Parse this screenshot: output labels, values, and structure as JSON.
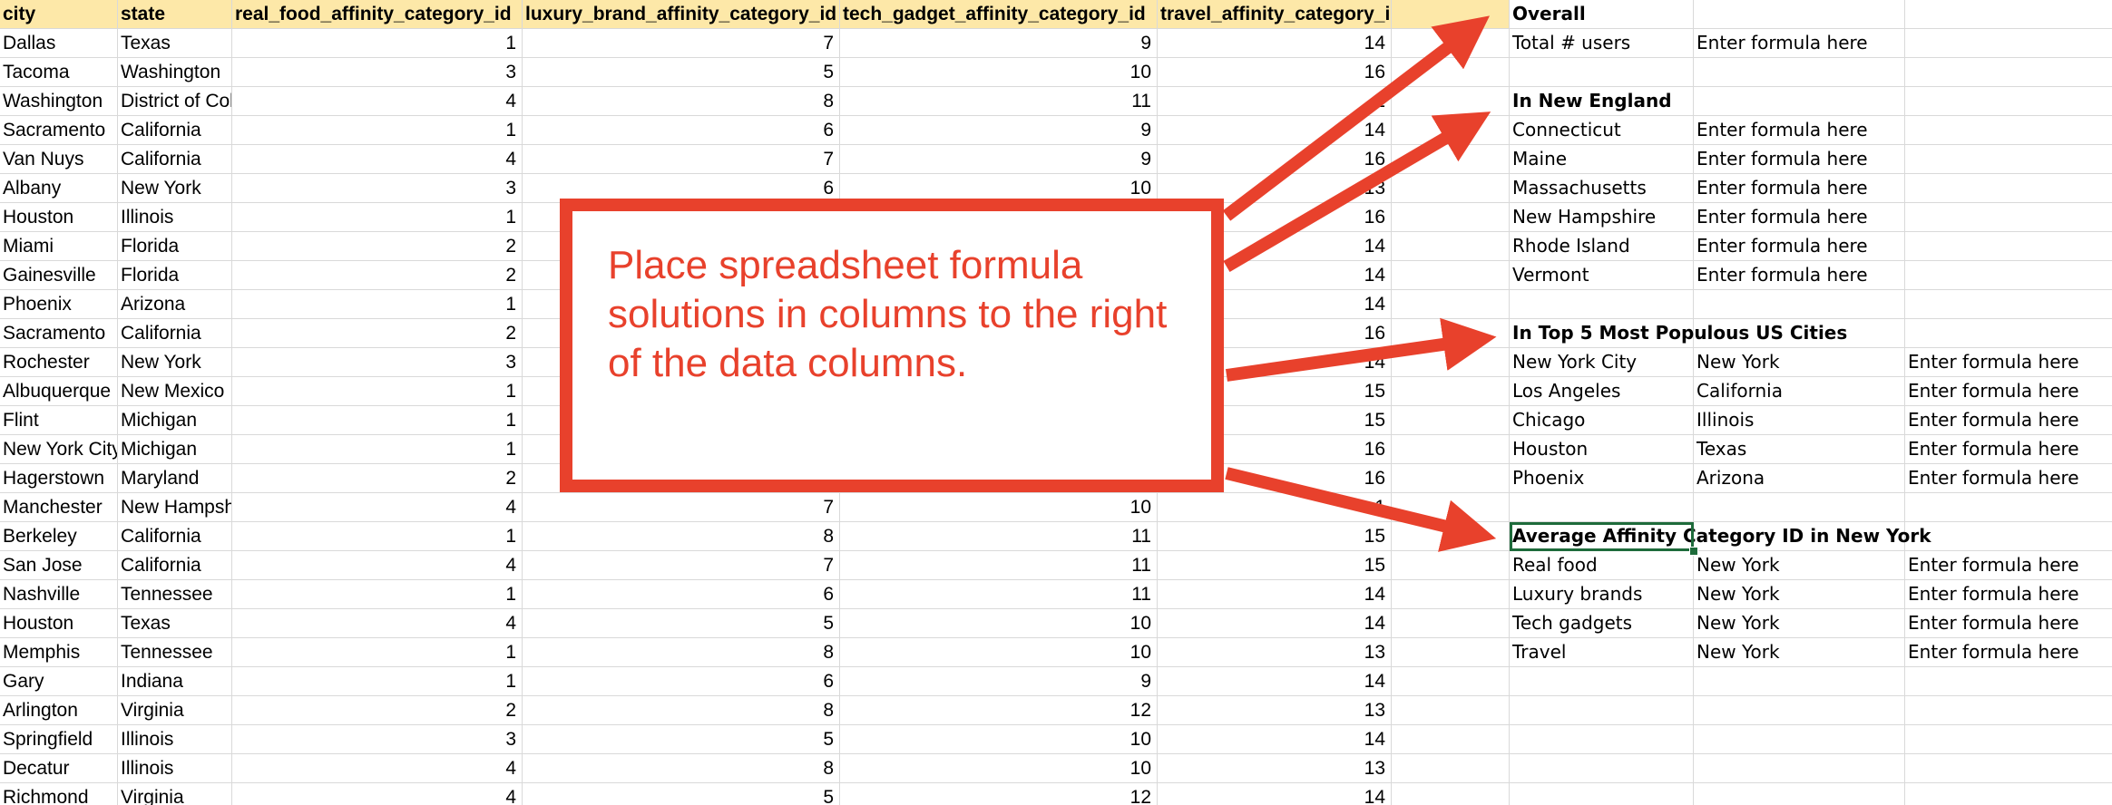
{
  "sheet": {
    "headers": [
      "city",
      "state",
      "real_food_affinity_category_id",
      "luxury_brand_affinity_category_id",
      "tech_gadget_affinity_category_id",
      "travel_affinity_category_id"
    ],
    "rows": [
      [
        "Dallas",
        "Texas",
        "1",
        "7",
        "9",
        "14"
      ],
      [
        "Tacoma",
        "Washington",
        "3",
        "5",
        "10",
        "16"
      ],
      [
        "Washington",
        "District of Columbia",
        "4",
        "8",
        "11",
        "1"
      ],
      [
        "Sacramento",
        "California",
        "1",
        "6",
        "9",
        "14"
      ],
      [
        "Van Nuys",
        "California",
        "4",
        "7",
        "9",
        "16"
      ],
      [
        "Albany",
        "New York",
        "3",
        "6",
        "10",
        "13"
      ],
      [
        "Houston",
        "Illinois",
        "1",
        "",
        "",
        "16"
      ],
      [
        "Miami",
        "Florida",
        "2",
        "",
        "",
        "14"
      ],
      [
        "Gainesville",
        "Florida",
        "2",
        "",
        "",
        "14"
      ],
      [
        "Phoenix",
        "Arizona",
        "1",
        "",
        "",
        "14"
      ],
      [
        "Sacramento",
        "California",
        "2",
        "",
        "",
        "16"
      ],
      [
        "Rochester",
        "New York",
        "3",
        "",
        "",
        "14"
      ],
      [
        "Albuquerque",
        "New Mexico",
        "1",
        "",
        "",
        "15"
      ],
      [
        "Flint",
        "Michigan",
        "1",
        "",
        "",
        "15"
      ],
      [
        "New York City",
        "Michigan",
        "1",
        "",
        "",
        "16"
      ],
      [
        "Hagerstown",
        "Maryland",
        "2",
        "",
        "",
        "16"
      ],
      [
        "Manchester",
        "New Hampshire",
        "4",
        "7",
        "10",
        "1"
      ],
      [
        "Berkeley",
        "California",
        "1",
        "8",
        "11",
        "15"
      ],
      [
        "San Jose",
        "California",
        "4",
        "7",
        "11",
        "15"
      ],
      [
        "Nashville",
        "Tennessee",
        "1",
        "6",
        "11",
        "14"
      ],
      [
        "Houston",
        "Texas",
        "4",
        "5",
        "10",
        "14"
      ],
      [
        "Memphis",
        "Tennessee",
        "1",
        "8",
        "10",
        "13"
      ],
      [
        "Gary",
        "Indiana",
        "1",
        "6",
        "9",
        "14"
      ],
      [
        "Arlington",
        "Virginia",
        "2",
        "8",
        "12",
        "13"
      ],
      [
        "Springfield",
        "Illinois",
        "3",
        "5",
        "10",
        "14"
      ],
      [
        "Decatur",
        "Illinois",
        "4",
        "8",
        "10",
        "13"
      ],
      [
        "Richmond",
        "Virginia",
        "4",
        "5",
        "12",
        "14"
      ]
    ],
    "right_panel": [
      [
        "Overall",
        "",
        ""
      ],
      [
        "Total # users",
        "Enter formula here",
        ""
      ],
      [
        "",
        "",
        ""
      ],
      [
        "In New England",
        "",
        ""
      ],
      [
        "Connecticut",
        "Enter formula here",
        ""
      ],
      [
        "Maine",
        "Enter formula here",
        ""
      ],
      [
        "Massachusetts",
        "Enter formula here",
        ""
      ],
      [
        "New Hampshire",
        "Enter formula here",
        ""
      ],
      [
        "Rhode Island",
        "Enter formula here",
        ""
      ],
      [
        "Vermont",
        "Enter formula here",
        ""
      ],
      [
        "",
        "",
        ""
      ],
      [
        "In Top 5 Most Populous US Cities",
        "",
        ""
      ],
      [
        "New York City",
        "New York",
        "Enter formula here"
      ],
      [
        "Los Angeles",
        "California",
        "Enter formula here"
      ],
      [
        "Chicago",
        "Illinois",
        "Enter formula here"
      ],
      [
        "Houston",
        "Texas",
        "Enter formula here"
      ],
      [
        "Phoenix",
        "Arizona",
        "Enter formula here"
      ],
      [
        "",
        "",
        ""
      ],
      [
        "Average Affinity Category ID in New York",
        "",
        ""
      ],
      [
        "Real food",
        "New York",
        "Enter formula here"
      ],
      [
        "Luxury brands",
        "New York",
        "Enter formula here"
      ],
      [
        "Tech gadgets",
        "New York",
        "Enter formula here"
      ],
      [
        "Travel",
        "New York",
        "Enter formula here"
      ],
      [
        "",
        "",
        ""
      ],
      [
        "",
        "",
        ""
      ],
      [
        "",
        "",
        ""
      ],
      [
        "",
        "",
        ""
      ],
      [
        "",
        "",
        ""
      ]
    ],
    "section_rows": [
      0,
      3,
      11,
      18
    ]
  },
  "callout": {
    "text": "Place spreadsheet formula solutions in columns to the right of the data columns."
  },
  "colors": {
    "header_fill": "#fde8a8",
    "callout_red": "#e8412c",
    "selection_green": "#1e6b3b",
    "grid_line": "#d9d9d9"
  }
}
